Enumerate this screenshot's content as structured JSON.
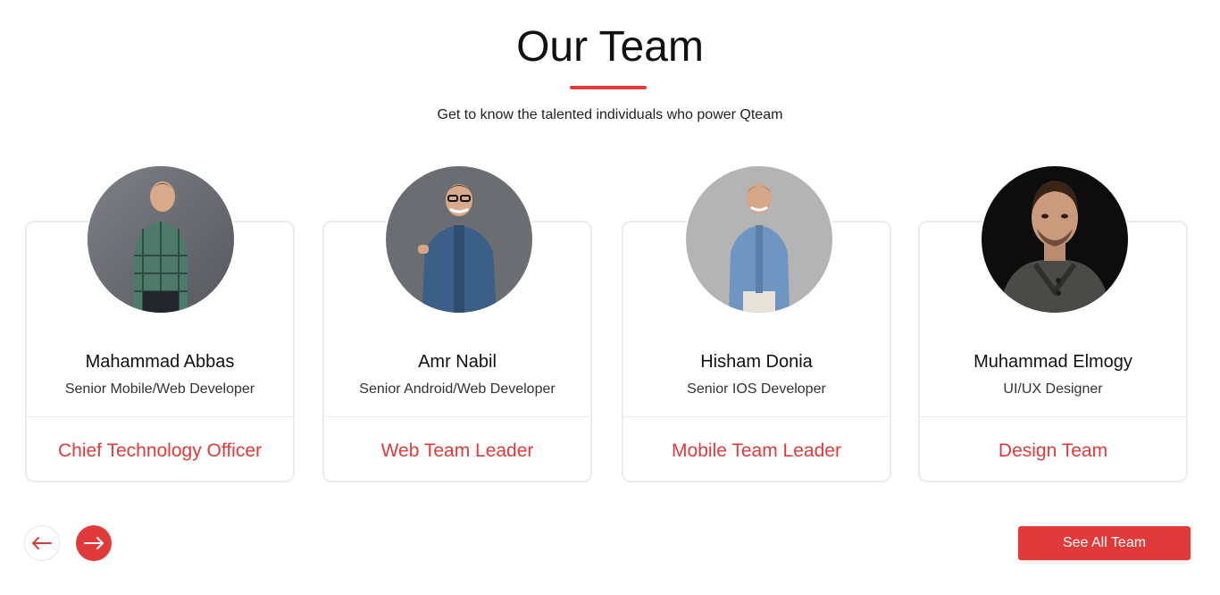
{
  "section": {
    "title": "Our Team",
    "subtitle": "Get to know the talented individuals who power Qteam"
  },
  "members": [
    {
      "name": "Mahammad Abbas",
      "role": "Senior Mobile/Web Developer",
      "team": "Chief Technology Officer",
      "photo": "man-in-plaid-shirt"
    },
    {
      "name": "Amr Nabil",
      "role": "Senior Android/Web Developer",
      "team": "Web Team Leader",
      "photo": "man-in-denim-shirt-pointing"
    },
    {
      "name": "Hisham Donia",
      "role": "Senior IOS Developer",
      "team": "Mobile Team Leader",
      "photo": "man-in-light-denim-shirt"
    },
    {
      "name": "Muhammad Elmogy",
      "role": "UI/UX Designer",
      "team": "Design Team",
      "photo": "man-in-dark-sweater"
    }
  ],
  "controls": {
    "prev_icon": "arrow-left-icon",
    "next_icon": "arrow-right-icon",
    "see_all_label": "See All Team"
  },
  "colors": {
    "accent": "#e03a3a",
    "text": "#111111",
    "border": "#ececec"
  }
}
